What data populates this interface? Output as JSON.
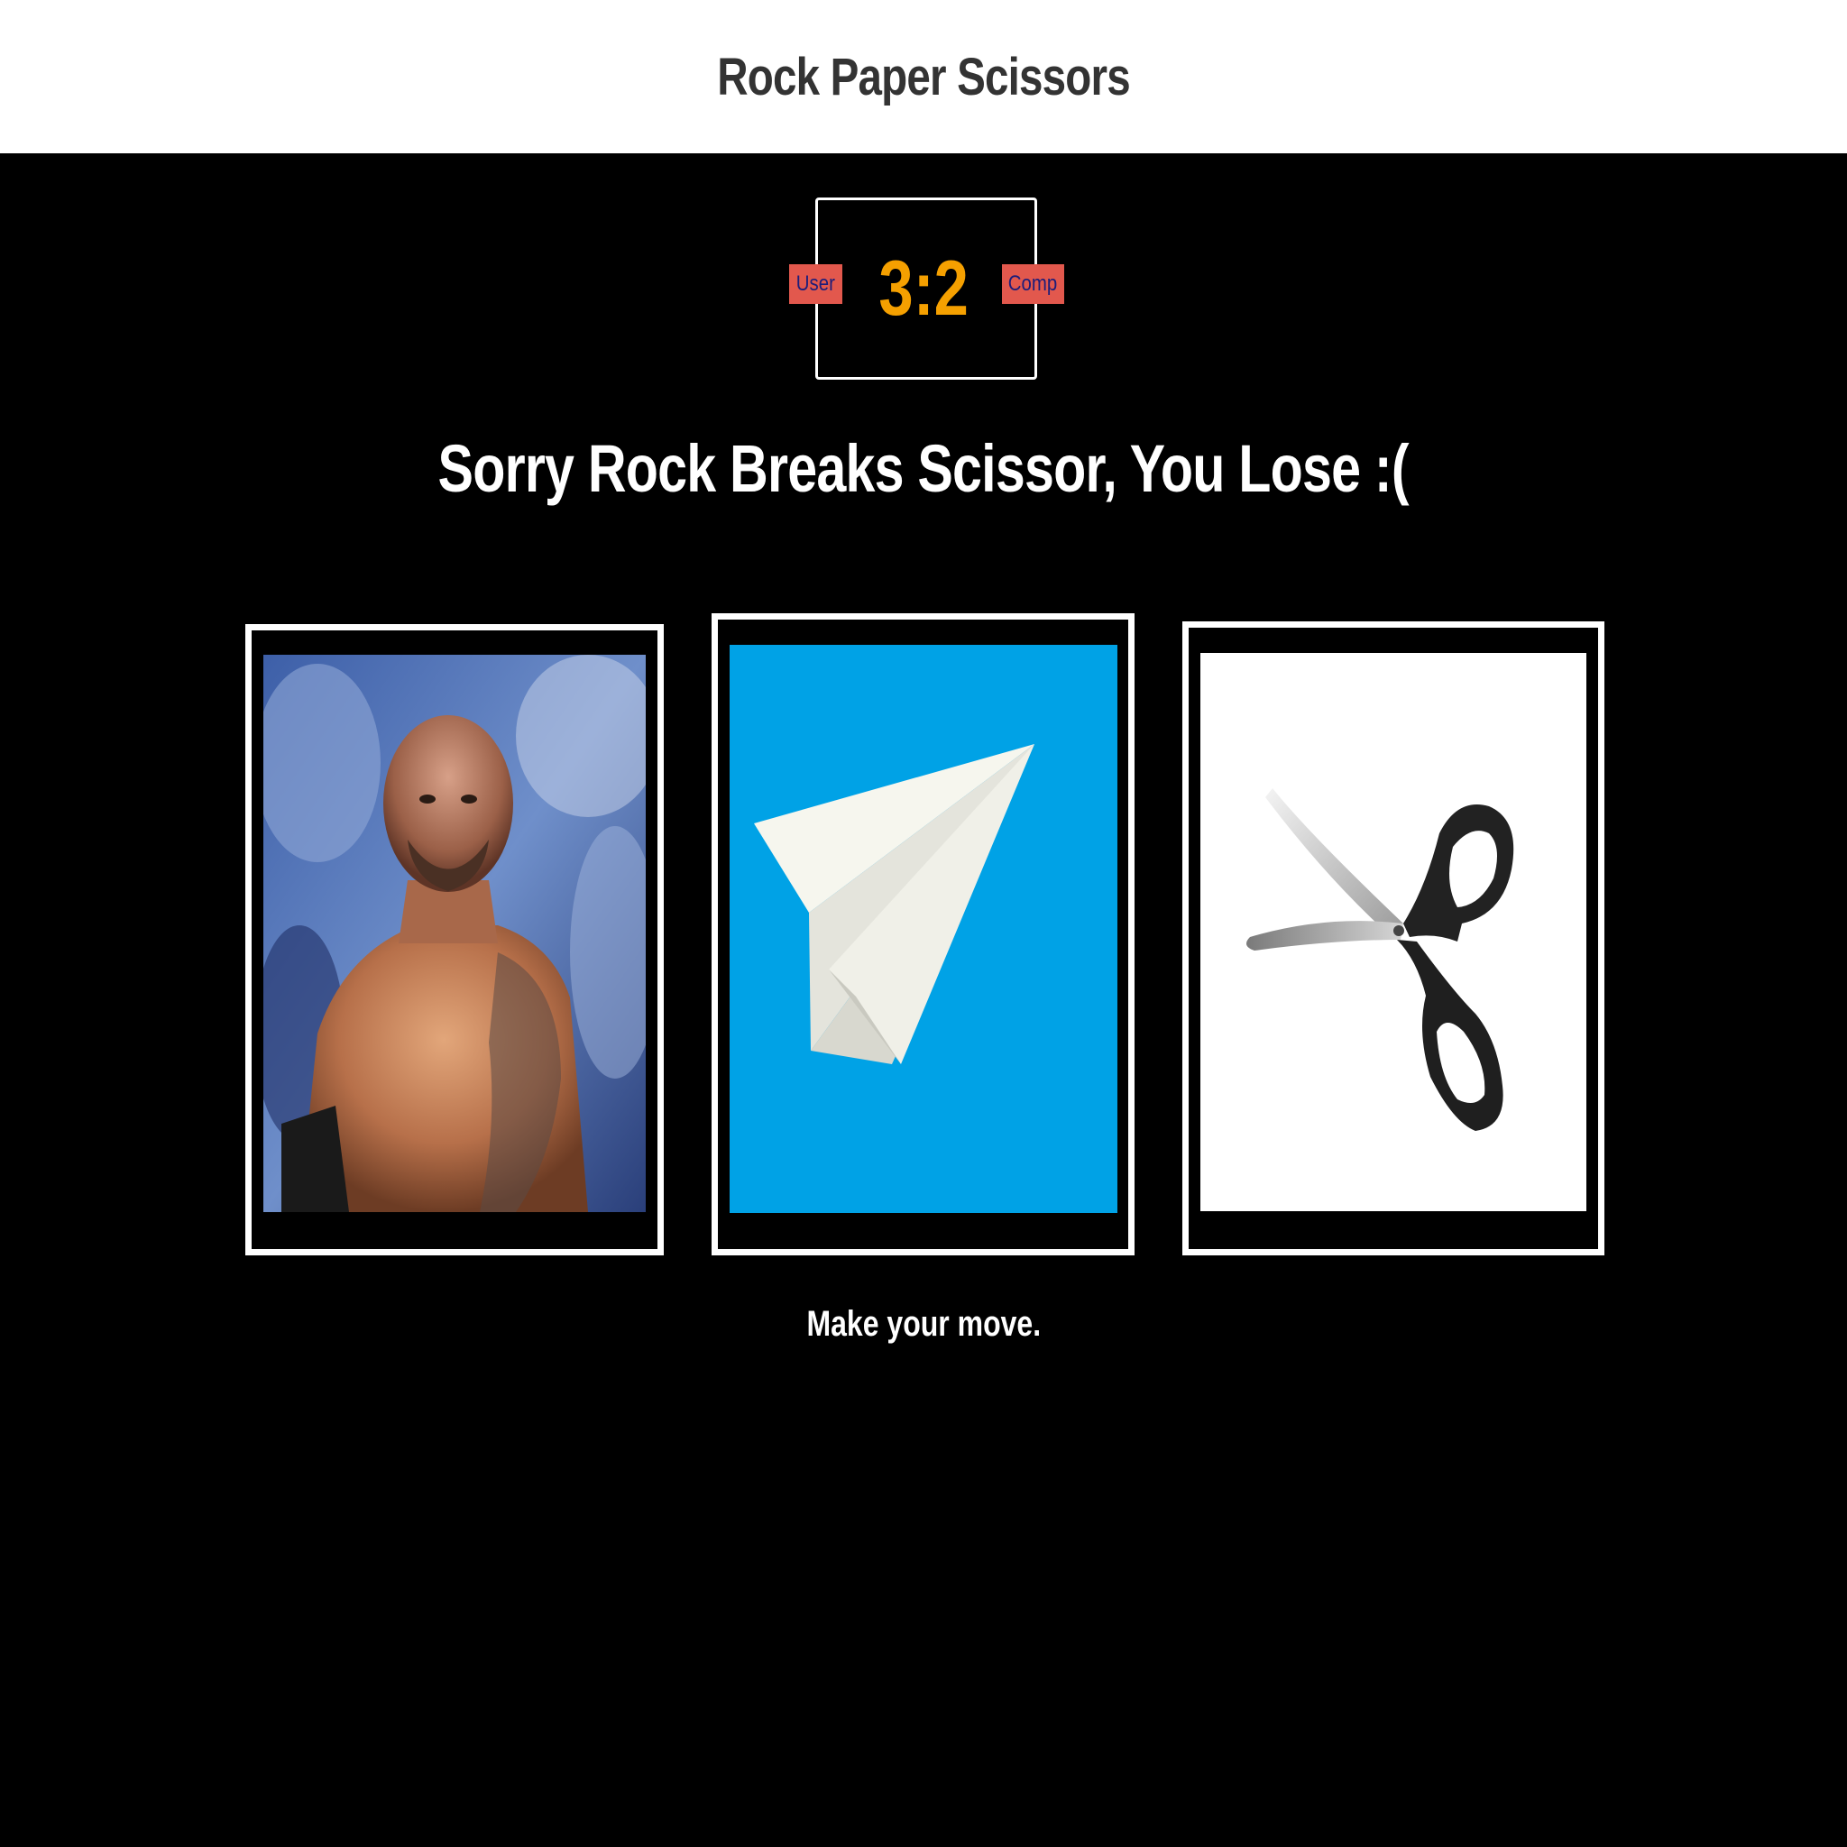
{
  "header": {
    "title": "Rock Paper Scissors"
  },
  "scoreboard": {
    "user_label": "User",
    "comp_label": "Comp",
    "score": "3:2",
    "user_score": 3,
    "comp_score": 2,
    "score_color": "#f5a000",
    "badge_color": "#e2584d"
  },
  "result": {
    "message": "Sorry Rock Breaks Scissor, You Lose :("
  },
  "choices": [
    {
      "name": "rock",
      "image": "wrestler-photo"
    },
    {
      "name": "paper",
      "image": "paper-plane-icon"
    },
    {
      "name": "scissors",
      "image": "scissors-icon"
    }
  ],
  "prompt": {
    "text": "Make your move."
  },
  "colors": {
    "background": "#000000",
    "header_background": "#ffffff",
    "paper_background": "#00a2e6"
  }
}
